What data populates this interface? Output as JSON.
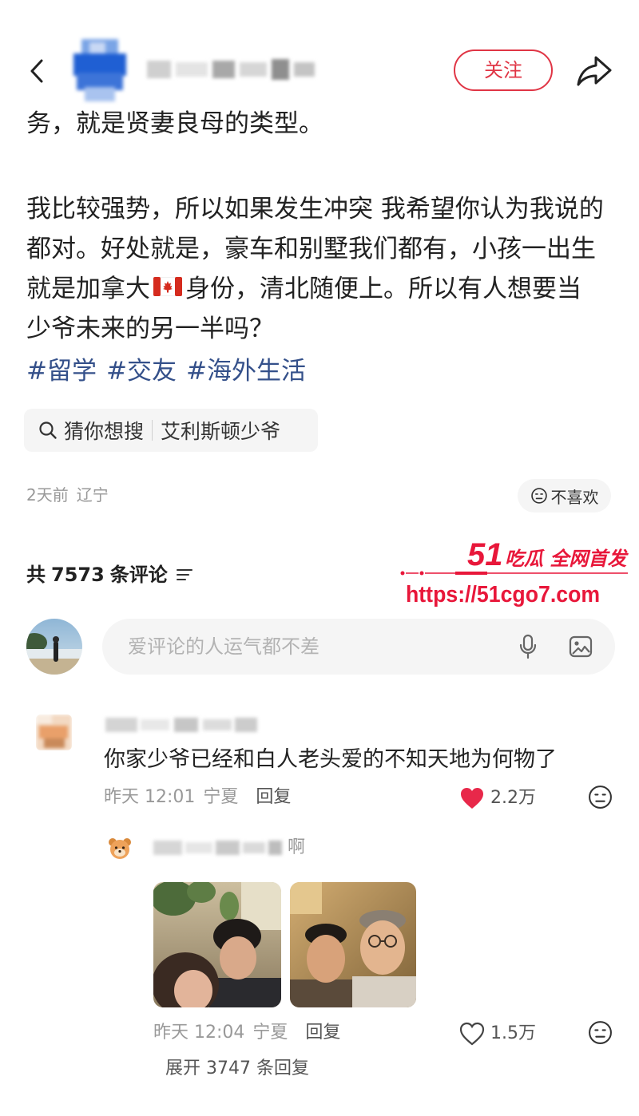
{
  "app": {
    "colors": {
      "accent": "#e03545",
      "hashtag": "#34508a",
      "like_active": "#e8284a",
      "watermark": "#e8173a",
      "muted": "#999999"
    }
  },
  "header": {
    "follow_label": "关注",
    "back_icon": "back-arrow-icon",
    "share_icon": "share-icon"
  },
  "post": {
    "line_0": "务，就是贤妻良母的类型。",
    "line_1": "我比较强势，所以如果发生冲突 我希望你认为我说的",
    "line_2": "都对。好处就是，豪车和别墅我们都有，小孩一出生",
    "line_3_before": "就是加拿大",
    "line_3_emoji": "canada-flag-icon",
    "line_3_after": "身份，清北随便上。所以有人想要当",
    "line_4": "少爷未来的另一半吗？",
    "hashtags": [
      "#留学",
      "#交友",
      "#海外生活"
    ]
  },
  "search_suggestion": {
    "icon": "search-icon",
    "label": "猜你想搜",
    "query": "艾利斯顿少爷"
  },
  "post_meta": {
    "time": "2天前",
    "location": "辽宁",
    "dislike_icon": "neutral-face-icon",
    "dislike_label": "不喜欢"
  },
  "comments_header": {
    "prefix": "共",
    "count": "7573",
    "suffix": "条评论",
    "sort_icon": "filter-icon"
  },
  "watermark": {
    "brand_number": "51",
    "brand_text": "吃瓜 全网首发",
    "url": "https://51cgo7.com"
  },
  "comment_box": {
    "placeholder": "爱评论的人运气都不差",
    "mic_icon": "microphone-icon",
    "image_icon": "image-icon"
  },
  "comments": [
    {
      "text": "你家少爷已经和白人老头爱的不知天地为何物了",
      "time": "昨天 12:01",
      "location": "宁夏",
      "reply_label": "回复",
      "likes": "2.2万",
      "liked": true,
      "replies": [
        {
          "user_name_visible": "啊",
          "time": "昨天 12:04",
          "location": "宁夏",
          "reply_label": "回复",
          "likes": "1.5万",
          "liked": false
        }
      ],
      "expand_label": "展开 3747 条回复"
    }
  ]
}
